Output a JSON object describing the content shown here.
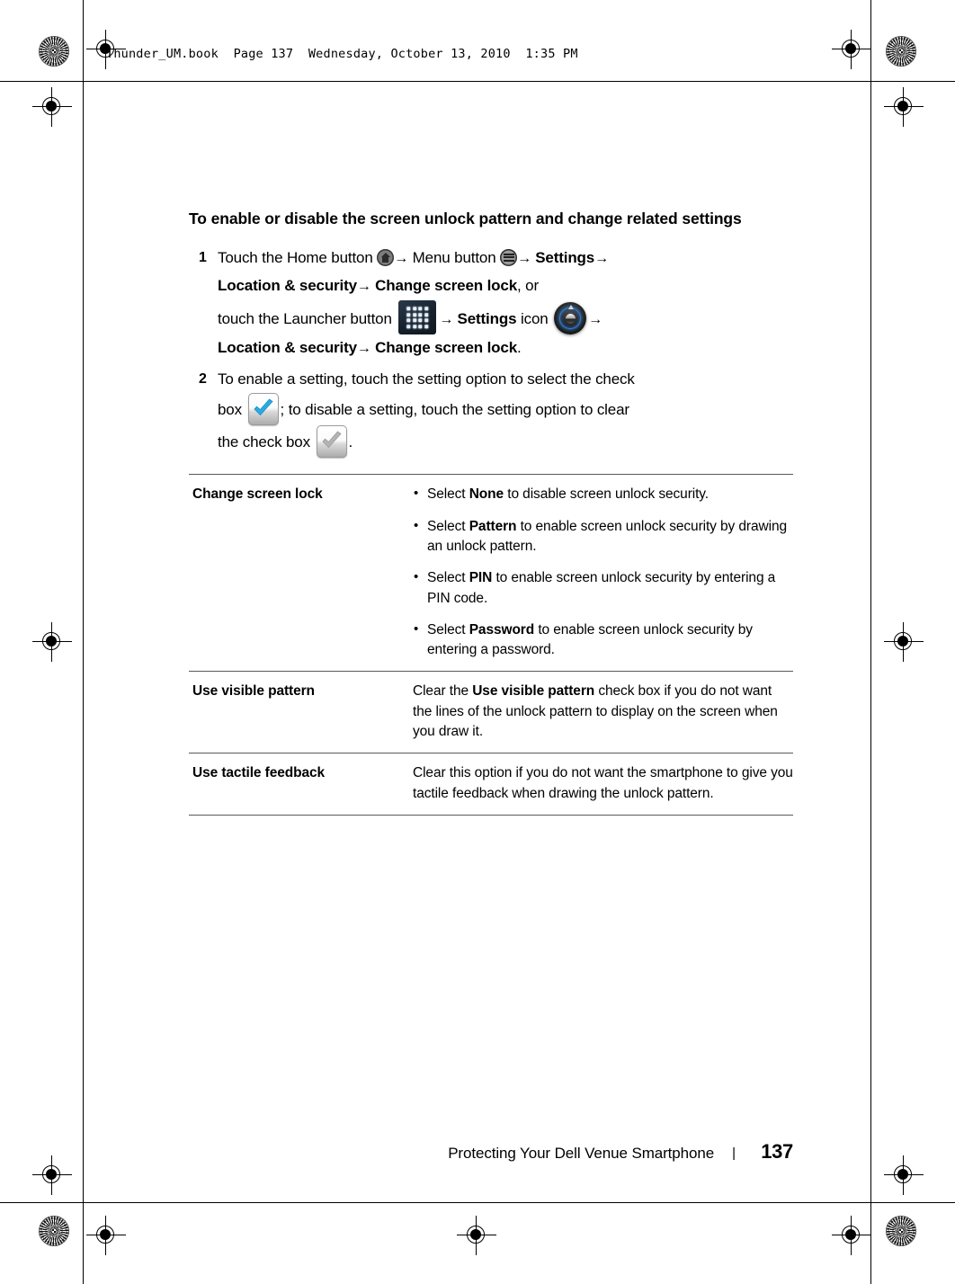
{
  "file_header": "Thunder_UM.book  Page 137  Wednesday, October 13, 2010  1:35 PM",
  "section": {
    "title": "To enable or disable the screen unlock pattern and change related settings"
  },
  "steps": [
    {
      "number": "1",
      "line1_a": "Touch the Home button ",
      "line1_arrow1": "→",
      "line1_b": " Menu button ",
      "line1_arrow2": "→ ",
      "line1_bold1": "Settings",
      "line1_arrow3": "→",
      "line2_bold1": "Location & security",
      "line2_arrow1": "→ ",
      "line2_bold2": "Change screen lock",
      "line2_tail": ", or",
      "line3_a": "touch the Launcher button ",
      "line3_arrow1": "→ ",
      "line3_bold1": "Settings",
      "line3_b": " icon ",
      "line3_arrow2": "→",
      "line4_bold1": "Location & security",
      "line4_arrow1": "→ ",
      "line4_bold2": "Change screen lock",
      "line4_tail": "."
    },
    {
      "number": "2",
      "line1": "To enable a setting, touch the setting option to select the check",
      "line2_a": "box ",
      "line2_b": "; to disable a setting, touch the setting option to clear",
      "line3_a": "the check box ",
      "line3_b": "."
    }
  ],
  "settings_table": {
    "rows": [
      {
        "name": "Change screen lock",
        "bullets": [
          {
            "pre": "Select ",
            "bold": "None",
            "post": " to disable screen unlock security."
          },
          {
            "pre": "Select ",
            "bold": "Pattern",
            "post": " to enable screen unlock security by drawing an unlock pattern."
          },
          {
            "pre": "Select ",
            "bold": "PIN",
            "post": " to enable screen unlock security by entering a PIN code."
          },
          {
            "pre": "Select ",
            "bold": "Password",
            "post": " to enable screen unlock security by entering a password."
          }
        ]
      },
      {
        "name": "Use visible pattern",
        "desc_pre": "Clear the ",
        "desc_bold": "Use visible pattern",
        "desc_post": " check box if you do not want the lines of the unlock pattern to display on the screen when you draw it."
      },
      {
        "name": "Use tactile feedback",
        "desc_pre": "Clear this option if you do not want the smartphone to give you tactile feedback when drawing the unlock pattern.",
        "desc_bold": "",
        "desc_post": ""
      }
    ]
  },
  "footer": {
    "title": "Protecting Your Dell Venue Smartphone",
    "separator": "|",
    "page_number": "137"
  },
  "icons": {
    "home": "home-button-icon",
    "menu": "menu-button-icon",
    "launcher": "launcher-grid-icon",
    "settings": "settings-dial-icon",
    "checkbox_checked": "checkbox-checked-icon",
    "checkbox_cleared": "checkbox-cleared-icon"
  },
  "colors": {
    "text": "#000000",
    "rule": "#58595b",
    "launcher_bg": "#16202c",
    "settings_ring": "#2d7fd8",
    "check_blue": "#29ABE2"
  }
}
